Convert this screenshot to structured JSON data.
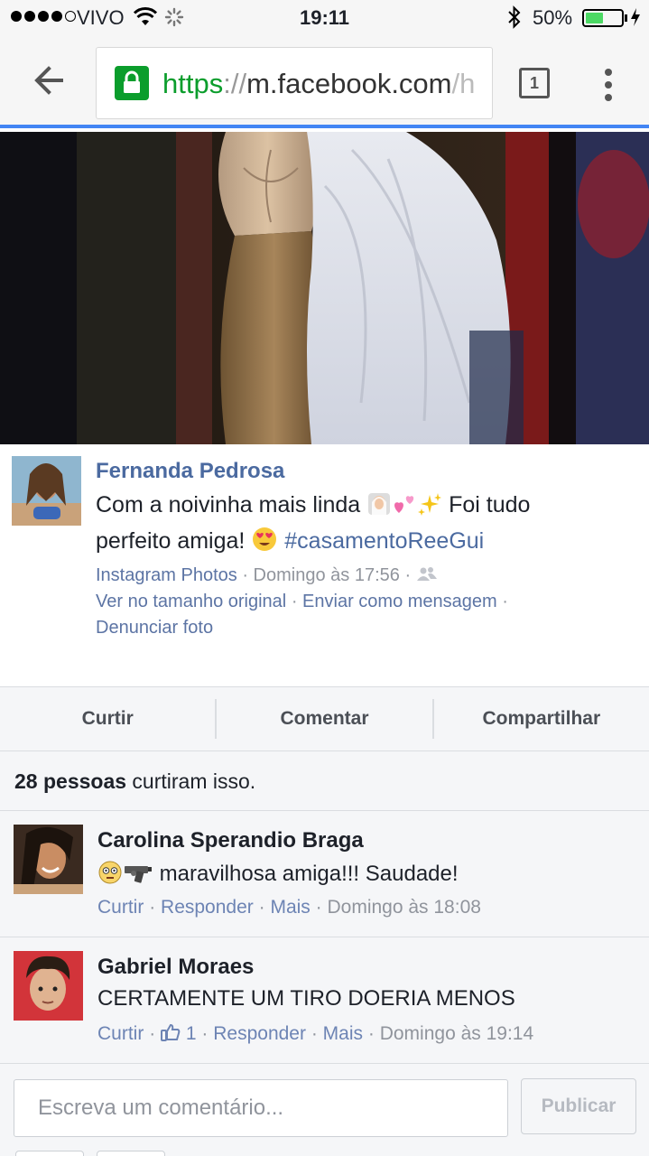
{
  "status_bar": {
    "carrier": "VIVO",
    "time": "19:11",
    "battery_percent_label": "50%",
    "battery_level": 0.5,
    "signal_bars_filled": 4,
    "signal_bars_total": 5
  },
  "browser": {
    "url_scheme": "https",
    "url_separator": "://",
    "url_host": "m.facebook.com",
    "url_path": "/h",
    "tab_count": "1",
    "lock_color": "#0b9d2c",
    "progress_color": "#4285f4"
  },
  "post": {
    "author": "Fernanda Pedrosa",
    "caption_line1": "Com a noivinha mais linda",
    "caption_line1_end": "Foi tudo",
    "caption_line2": "perfeito amiga!",
    "hashtag": "#casamentoReeGui",
    "source": "Instagram Photos",
    "dot": "·",
    "timestamp": "Domingo às 17:56",
    "view_full": "Ver no tamanho original",
    "send_message": "Enviar como mensagem",
    "report": "Denunciar foto",
    "audience_icon": "friends-icon"
  },
  "actions": {
    "like": "Curtir",
    "comment": "Comentar",
    "share": "Compartilhar"
  },
  "likes": {
    "count_text": "28 pessoas",
    "suffix": "curtiram isso."
  },
  "comments": [
    {
      "name": "Carolina Sperandio Braga",
      "text": "maravilhosa amiga!!! Saudade!",
      "like": "Curtir",
      "reply": "Responder",
      "more": "Mais",
      "time": "Domingo às 18:08"
    },
    {
      "name": "Gabriel Moraes",
      "text": "CERTAMENTE UM TIRO DOERIA MENOS",
      "like": "Curtir",
      "reactions": "1",
      "reply": "Responder",
      "more": "Mais",
      "time": "Domingo às 19:14"
    }
  ],
  "compose": {
    "placeholder": "Escreva um comentário...",
    "publish": "Publicar"
  },
  "colors": {
    "link_blue": "#4b6aa0",
    "meta_gray": "#90949c",
    "background": "#f5f6f8"
  }
}
